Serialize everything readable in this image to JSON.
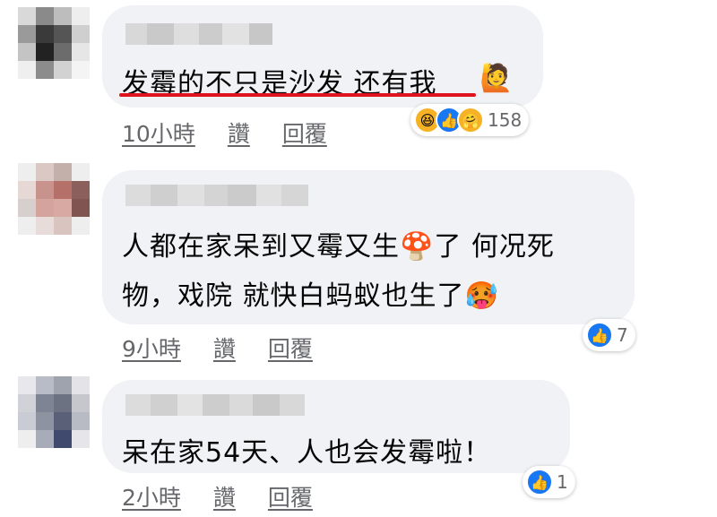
{
  "comments": [
    {
      "text": "发霉的不只是沙发 还有我",
      "time": "10小時",
      "like_label": "讚",
      "reply_label": "回覆",
      "reaction_count": "158",
      "reactions": [
        "haha-icon",
        "like-icon",
        "care-icon"
      ]
    },
    {
      "text_line1": "人都在家呆到又霉又生",
      "text_line1b": "了 何况死",
      "text_line2": "物，戏院 就快白蚂蚁也生了",
      "time": "9小時",
      "like_label": "讚",
      "reply_label": "回覆",
      "reaction_count": "7",
      "reactions": [
        "like-icon"
      ]
    },
    {
      "text": "呆在家54天、人也会发霉啦！",
      "time": "2小時",
      "like_label": "讚",
      "reply_label": "回覆",
      "reaction_count": "1",
      "reactions": [
        "like-icon"
      ]
    }
  ],
  "colors": {
    "bubble": "#f0f2f5",
    "like_blue": "#1877f2",
    "underline": "#e0141e",
    "meta": "#65676b"
  }
}
